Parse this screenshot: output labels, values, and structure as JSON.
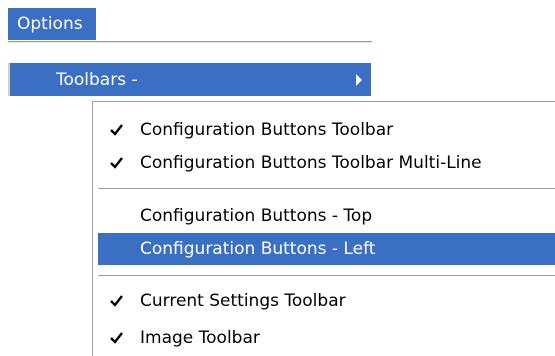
{
  "menubar": {
    "options_label": "Options"
  },
  "options_menu": {
    "toolbars_label": "Toolbars -"
  },
  "submenu": {
    "items": [
      {
        "label": "Configuration Buttons Toolbar",
        "checked": true
      },
      {
        "label": "Configuration Buttons Toolbar Multi-Line",
        "checked": true
      },
      {
        "label": "Configuration Buttons - Top",
        "checked": false
      },
      {
        "label": "Configuration Buttons - Left",
        "checked": false,
        "highlighted": true
      },
      {
        "label": "Current Settings Toolbar",
        "checked": true
      },
      {
        "label": "Image Toolbar",
        "checked": true
      }
    ]
  },
  "colors": {
    "highlight": "#3a6fc4",
    "separator": "#a0a0a0"
  },
  "icons": {
    "check": "check-mark-icon",
    "submenu_arrow": "chevron-right-icon"
  }
}
